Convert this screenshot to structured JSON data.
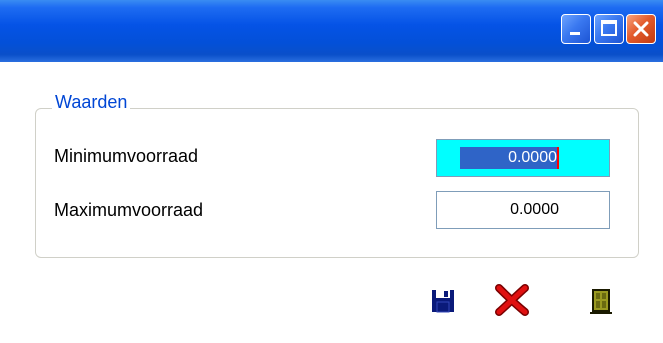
{
  "window": {
    "title": "",
    "controls": {
      "minimize": "minimize-icon",
      "maximize": "maximize-icon",
      "close": "close-icon"
    }
  },
  "group": {
    "legend": "Waarden",
    "fields": [
      {
        "label": "Minimumvoorraad",
        "value": "0.0000",
        "focused": true,
        "selected": true
      },
      {
        "label": "Maximumvoorraad",
        "value": "0.0000",
        "focused": false
      }
    ]
  },
  "actions": [
    {
      "name": "save",
      "icon": "floppy-disk-icon"
    },
    {
      "name": "cancel",
      "icon": "red-x-icon"
    },
    {
      "name": "exit",
      "icon": "door-icon"
    }
  ],
  "colors": {
    "title_bar": "#0553e6",
    "focused_field_bg": "#00ffff",
    "selection_bg": "#2f64c7",
    "legend_text": "#0046d5",
    "cancel_red": "#d40000"
  }
}
